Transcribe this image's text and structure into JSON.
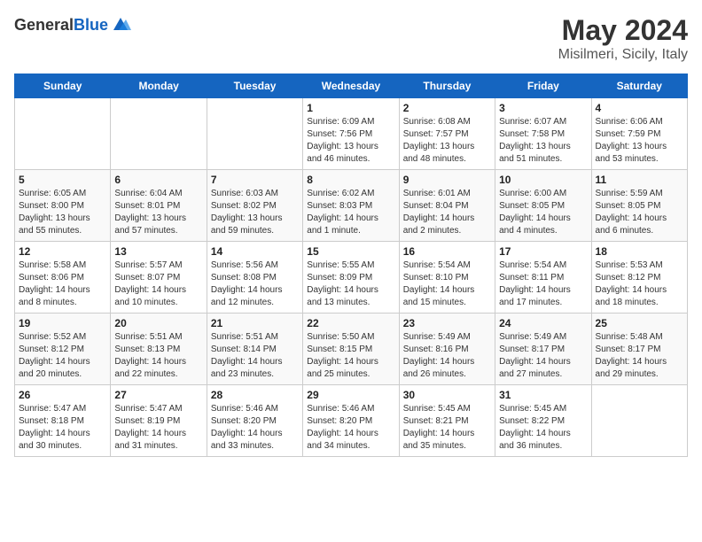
{
  "header": {
    "logo_general": "General",
    "logo_blue": "Blue",
    "title": "May 2024",
    "subtitle": "Misilmeri, Sicily, Italy"
  },
  "weekdays": [
    "Sunday",
    "Monday",
    "Tuesday",
    "Wednesday",
    "Thursday",
    "Friday",
    "Saturday"
  ],
  "weeks": [
    [
      {
        "day": "",
        "info": ""
      },
      {
        "day": "",
        "info": ""
      },
      {
        "day": "",
        "info": ""
      },
      {
        "day": "1",
        "info": "Sunrise: 6:09 AM\nSunset: 7:56 PM\nDaylight: 13 hours\nand 46 minutes."
      },
      {
        "day": "2",
        "info": "Sunrise: 6:08 AM\nSunset: 7:57 PM\nDaylight: 13 hours\nand 48 minutes."
      },
      {
        "day": "3",
        "info": "Sunrise: 6:07 AM\nSunset: 7:58 PM\nDaylight: 13 hours\nand 51 minutes."
      },
      {
        "day": "4",
        "info": "Sunrise: 6:06 AM\nSunset: 7:59 PM\nDaylight: 13 hours\nand 53 minutes."
      }
    ],
    [
      {
        "day": "5",
        "info": "Sunrise: 6:05 AM\nSunset: 8:00 PM\nDaylight: 13 hours\nand 55 minutes."
      },
      {
        "day": "6",
        "info": "Sunrise: 6:04 AM\nSunset: 8:01 PM\nDaylight: 13 hours\nand 57 minutes."
      },
      {
        "day": "7",
        "info": "Sunrise: 6:03 AM\nSunset: 8:02 PM\nDaylight: 13 hours\nand 59 minutes."
      },
      {
        "day": "8",
        "info": "Sunrise: 6:02 AM\nSunset: 8:03 PM\nDaylight: 14 hours\nand 1 minute."
      },
      {
        "day": "9",
        "info": "Sunrise: 6:01 AM\nSunset: 8:04 PM\nDaylight: 14 hours\nand 2 minutes."
      },
      {
        "day": "10",
        "info": "Sunrise: 6:00 AM\nSunset: 8:05 PM\nDaylight: 14 hours\nand 4 minutes."
      },
      {
        "day": "11",
        "info": "Sunrise: 5:59 AM\nSunset: 8:05 PM\nDaylight: 14 hours\nand 6 minutes."
      }
    ],
    [
      {
        "day": "12",
        "info": "Sunrise: 5:58 AM\nSunset: 8:06 PM\nDaylight: 14 hours\nand 8 minutes."
      },
      {
        "day": "13",
        "info": "Sunrise: 5:57 AM\nSunset: 8:07 PM\nDaylight: 14 hours\nand 10 minutes."
      },
      {
        "day": "14",
        "info": "Sunrise: 5:56 AM\nSunset: 8:08 PM\nDaylight: 14 hours\nand 12 minutes."
      },
      {
        "day": "15",
        "info": "Sunrise: 5:55 AM\nSunset: 8:09 PM\nDaylight: 14 hours\nand 13 minutes."
      },
      {
        "day": "16",
        "info": "Sunrise: 5:54 AM\nSunset: 8:10 PM\nDaylight: 14 hours\nand 15 minutes."
      },
      {
        "day": "17",
        "info": "Sunrise: 5:54 AM\nSunset: 8:11 PM\nDaylight: 14 hours\nand 17 minutes."
      },
      {
        "day": "18",
        "info": "Sunrise: 5:53 AM\nSunset: 8:12 PM\nDaylight: 14 hours\nand 18 minutes."
      }
    ],
    [
      {
        "day": "19",
        "info": "Sunrise: 5:52 AM\nSunset: 8:12 PM\nDaylight: 14 hours\nand 20 minutes."
      },
      {
        "day": "20",
        "info": "Sunrise: 5:51 AM\nSunset: 8:13 PM\nDaylight: 14 hours\nand 22 minutes."
      },
      {
        "day": "21",
        "info": "Sunrise: 5:51 AM\nSunset: 8:14 PM\nDaylight: 14 hours\nand 23 minutes."
      },
      {
        "day": "22",
        "info": "Sunrise: 5:50 AM\nSunset: 8:15 PM\nDaylight: 14 hours\nand 25 minutes."
      },
      {
        "day": "23",
        "info": "Sunrise: 5:49 AM\nSunset: 8:16 PM\nDaylight: 14 hours\nand 26 minutes."
      },
      {
        "day": "24",
        "info": "Sunrise: 5:49 AM\nSunset: 8:17 PM\nDaylight: 14 hours\nand 27 minutes."
      },
      {
        "day": "25",
        "info": "Sunrise: 5:48 AM\nSunset: 8:17 PM\nDaylight: 14 hours\nand 29 minutes."
      }
    ],
    [
      {
        "day": "26",
        "info": "Sunrise: 5:47 AM\nSunset: 8:18 PM\nDaylight: 14 hours\nand 30 minutes."
      },
      {
        "day": "27",
        "info": "Sunrise: 5:47 AM\nSunset: 8:19 PM\nDaylight: 14 hours\nand 31 minutes."
      },
      {
        "day": "28",
        "info": "Sunrise: 5:46 AM\nSunset: 8:20 PM\nDaylight: 14 hours\nand 33 minutes."
      },
      {
        "day": "29",
        "info": "Sunrise: 5:46 AM\nSunset: 8:20 PM\nDaylight: 14 hours\nand 34 minutes."
      },
      {
        "day": "30",
        "info": "Sunrise: 5:45 AM\nSunset: 8:21 PM\nDaylight: 14 hours\nand 35 minutes."
      },
      {
        "day": "31",
        "info": "Sunrise: 5:45 AM\nSunset: 8:22 PM\nDaylight: 14 hours\nand 36 minutes."
      },
      {
        "day": "",
        "info": ""
      }
    ]
  ]
}
